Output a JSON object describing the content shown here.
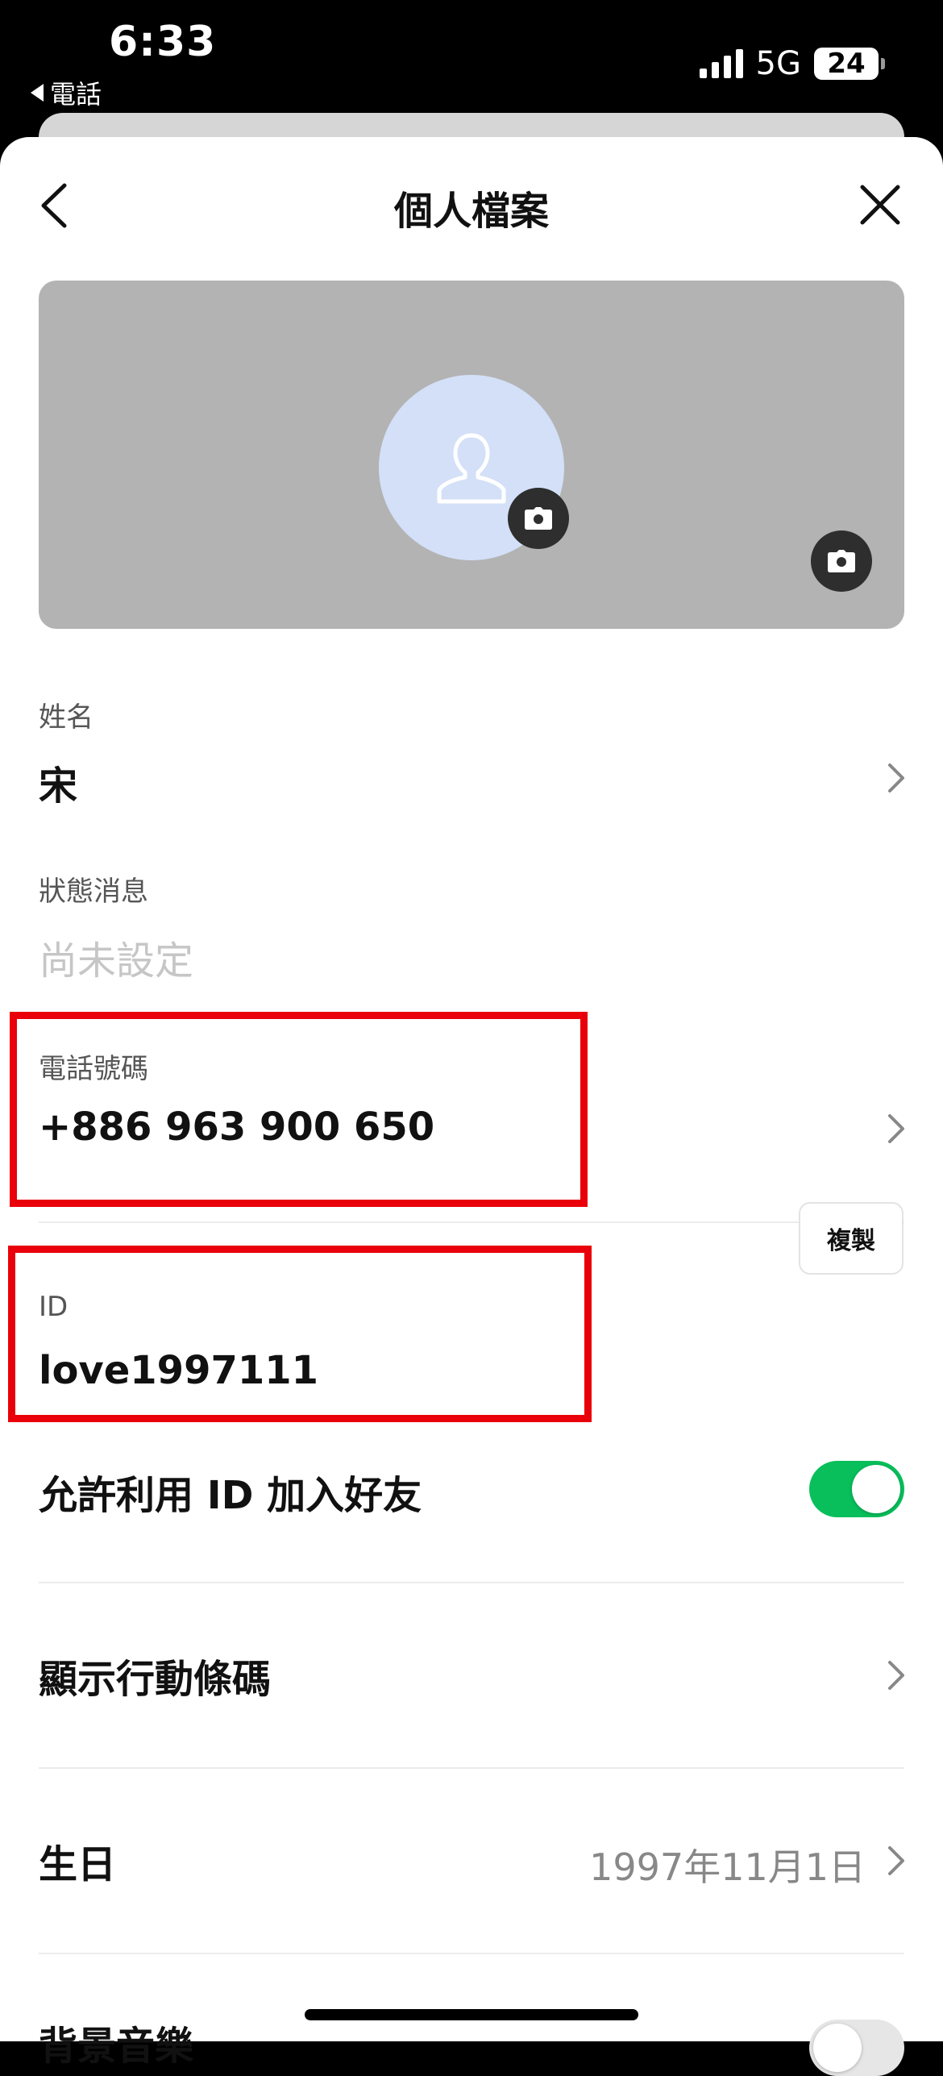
{
  "status_bar": {
    "time": "6:33",
    "back_app": "電話",
    "network": "5G",
    "battery": "24"
  },
  "header": {
    "title": "個人檔案"
  },
  "profile": {
    "name_label": "姓名",
    "name_value": "宋",
    "status_label": "狀態消息",
    "status_placeholder": "尚未設定",
    "phone_label": "電話號碼",
    "phone_value": "+886 963 900 650",
    "id_label": "ID",
    "id_value": "love1997111",
    "copy_label": "複製",
    "allow_id_label": "允許利用 ID 加入好友",
    "allow_id_enabled": true,
    "qr_label": "顯示行動條碼",
    "birthday_label": "生日",
    "birthday_value": "1997年11月1日",
    "bgm_label": "背景音樂",
    "bgm_enabled": false
  },
  "colors": {
    "toggle_on": "#08bf5b",
    "highlight_box": "#e9000a",
    "avatar_bg": "#d3e0f7",
    "cover_bg": "#b3b3b3"
  }
}
